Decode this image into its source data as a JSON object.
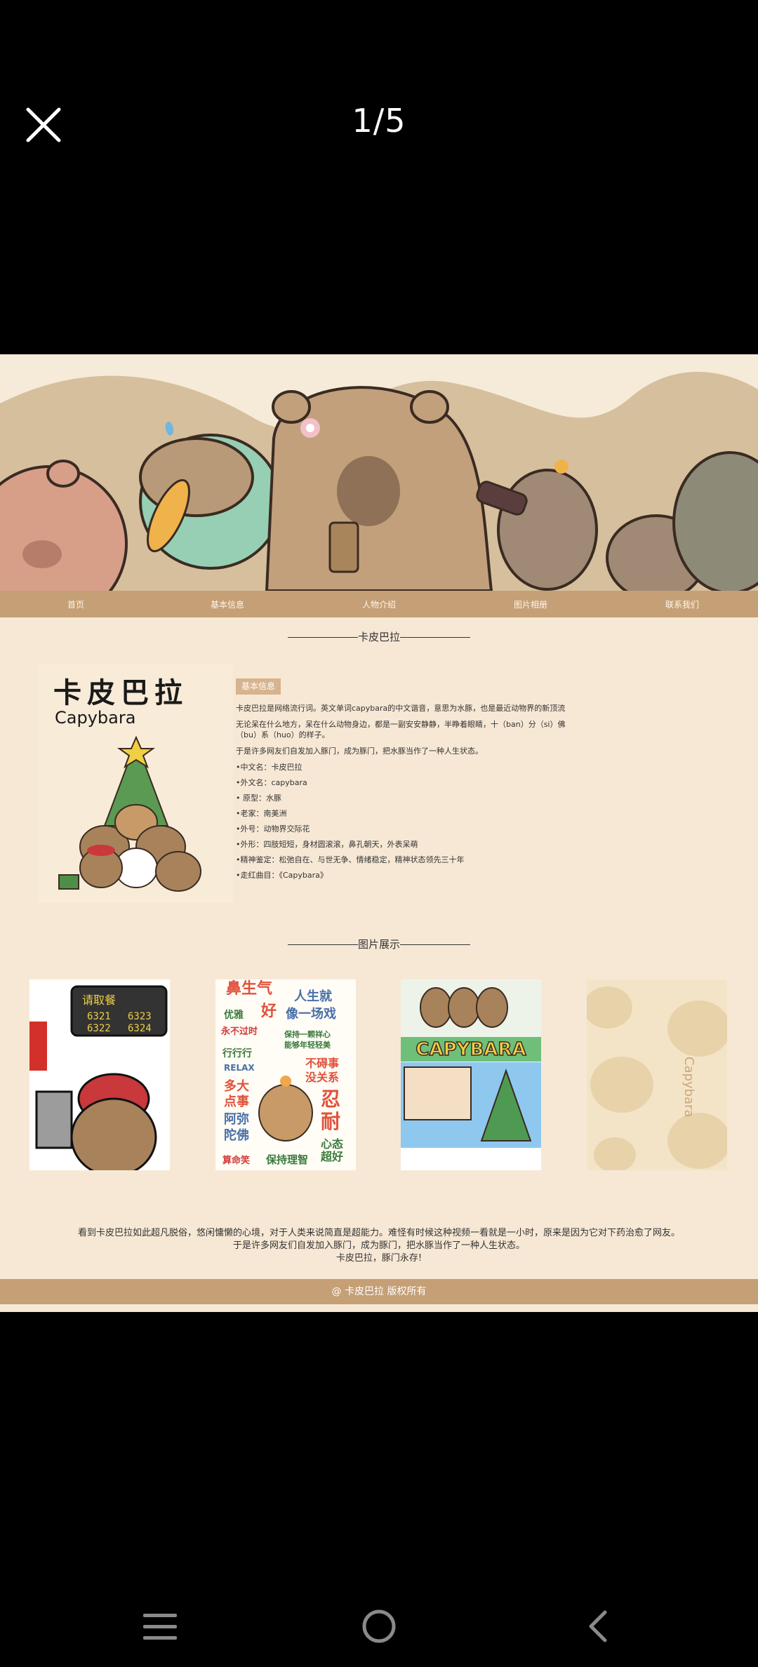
{
  "viewer": {
    "counter": "1/5"
  },
  "nav": {
    "items": [
      "首页",
      "基本信息",
      "人物介绍",
      "图片相册",
      "联系我们"
    ]
  },
  "intro": {
    "section_title": "卡皮巴拉",
    "card_title": "卡皮巴拉",
    "card_subtitle": "Capybara",
    "tag": "基本信息",
    "paragraphs": [
      "卡皮巴拉是网络流行词。英文单词capybara的中文谐音，意思为水豚，也是最近动物界的新顶流",
      "无论呆在什么地方，呆在什么动物身边，都是一副安安静静，半睁着眼睛，十（ban）分（si）佛（bu）系（huo）的样子。",
      "于是许多网友们自发加入豚门，成为豚门，把水豚当作了一种人生状态。"
    ],
    "facts": [
      "•中文名：卡皮巴拉",
      "•外文名：capybara",
      "• 原型：水豚",
      "•老家：南美洲",
      "•外号：动物界交际花",
      "•外形：四肢短短，身材圆滚滚，鼻孔朝天，外表呆萌",
      "•精神鉴定：松弛自在、与世无争、情绪稳定，精神状态领先三十年",
      "•走红曲目：《Capybara》"
    ]
  },
  "gallery": {
    "section_title": "图片展示",
    "item1_sign_title": "请取餐",
    "item1_sign_nums": [
      "6321",
      "6323",
      "6322",
      "6324"
    ],
    "item2_words": [
      "鼻生气",
      "人生就",
      "优雅",
      "好",
      "像一场戏",
      "永不过时",
      "保持一颗祥心",
      "能够年轻轻美",
      "行行行",
      "RELAX",
      "不碍事",
      "没关系",
      "多大",
      "点事",
      "忍",
      "耐",
      "阿弥",
      "陀佛",
      "心态",
      "超好",
      "算命笑",
      "保持理智"
    ],
    "item3_word": "CAPYBARA",
    "item4_word": "Capybara"
  },
  "footer": {
    "lines": [
      "看到卡皮巴拉如此超凡脱俗，悠闲慵懒的心境，对于人类来说简直是超能力。难怪有时候这种视频一看就是一小时，原来是因为它对下药治愈了网友。",
      "于是许多网友们自发加入豚门，成为豚门，把水豚当作了一种人生状态。",
      "卡皮巴拉，豚门永存!"
    ],
    "copyright": "@ 卡皮巴拉 版权所有"
  }
}
